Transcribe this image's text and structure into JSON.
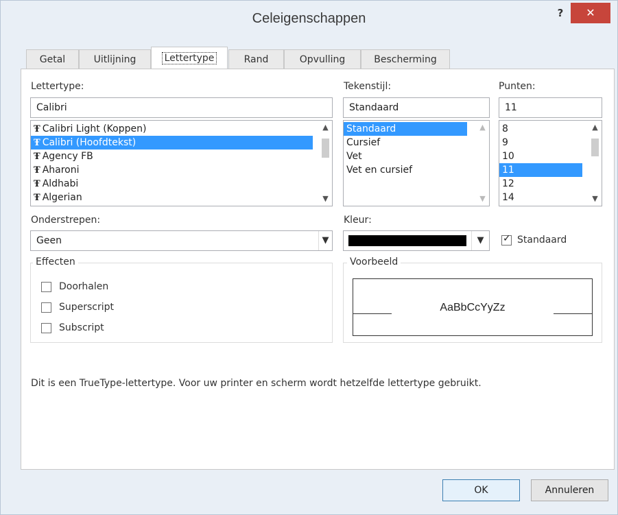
{
  "window": {
    "title": "Celeigenschappen",
    "help_label": "?",
    "close_label": "✕"
  },
  "tabs": [
    {
      "label": "Getal",
      "active": false
    },
    {
      "label": "Uitlijning",
      "active": false
    },
    {
      "label": "Lettertype",
      "active": true
    },
    {
      "label": "Rand",
      "active": false
    },
    {
      "label": "Opvulling",
      "active": false
    },
    {
      "label": "Bescherming",
      "active": false
    }
  ],
  "font": {
    "label": "Lettertype:",
    "value": "Calibri",
    "items": [
      "Calibri Light (Koppen)",
      "Calibri (Hoofdtekst)",
      "Agency FB",
      "Aharoni",
      "Aldhabi",
      "Algerian"
    ],
    "selected": "Calibri (Hoofdtekst)",
    "item_icon": "truetype-font-icon"
  },
  "style": {
    "label": "Tekenstijl:",
    "value": "Standaard",
    "items": [
      "Standaard",
      "Cursief",
      "Vet",
      "Vet en cursief"
    ],
    "selected": "Standaard"
  },
  "size": {
    "label": "Punten:",
    "value": "11",
    "items": [
      "8",
      "9",
      "10",
      "11",
      "12",
      "14"
    ],
    "selected": "11"
  },
  "underline": {
    "label": "Onderstrepen:",
    "value": "Geen"
  },
  "color": {
    "label": "Kleur:",
    "swatch": "#000000",
    "auto_label": "Standaard",
    "auto_checked": true
  },
  "effects": {
    "legend": "Effecten",
    "options": [
      {
        "label": "Doorhalen",
        "checked": false
      },
      {
        "label": "Superscript",
        "checked": false
      },
      {
        "label": "Subscript",
        "checked": false
      }
    ]
  },
  "preview": {
    "legend": "Voorbeeld",
    "sample": "AaBbCcYyZz"
  },
  "info_text": "Dit is een TrueType-lettertype. Voor uw printer en scherm wordt hetzelfde lettertype gebruikt.",
  "buttons": {
    "ok": "OK",
    "cancel": "Annuleren"
  },
  "colors": {
    "selection": "#3399ff",
    "close": "#c7453b"
  }
}
